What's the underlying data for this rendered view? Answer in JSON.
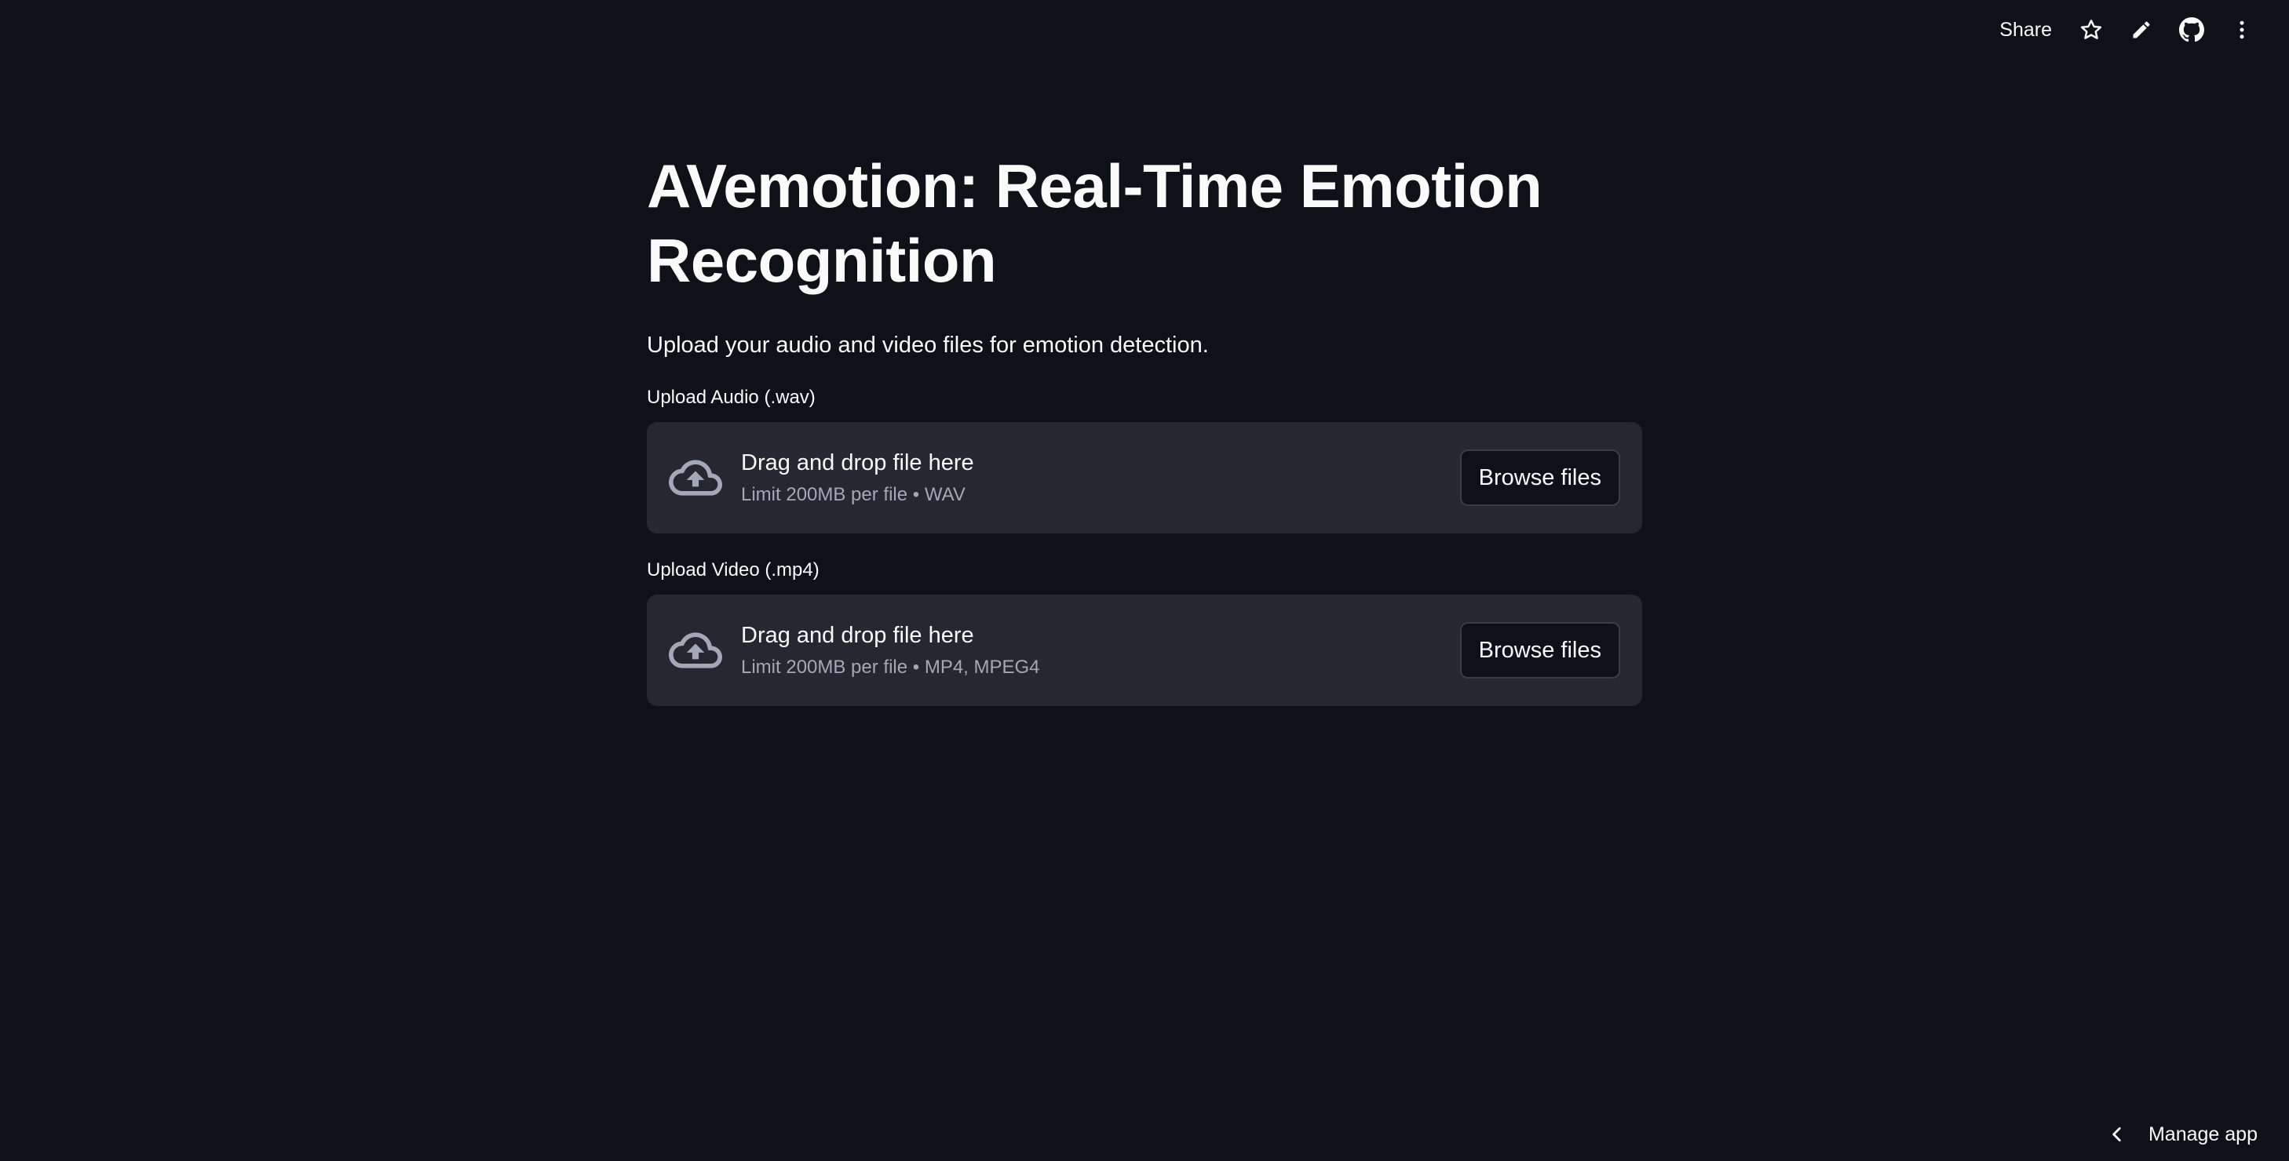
{
  "toolbar": {
    "share_label": "Share",
    "icons": [
      "star-icon",
      "pencil-icon",
      "github-icon",
      "more-vertical-icon"
    ]
  },
  "main": {
    "title": "AVemotion: Real-Time Emotion Recognition",
    "subtitle": "Upload your audio and video files for emotion detection.",
    "uploaders": [
      {
        "label": "Upload Audio (.wav)",
        "drop_text": "Drag and drop file here",
        "limit_text": "Limit 200MB per file • WAV",
        "button_label": "Browse files",
        "icon": "cloud-upload-icon"
      },
      {
        "label": "Upload Video (.mp4)",
        "drop_text": "Drag and drop file here",
        "limit_text": "Limit 200MB per file • MP4, MPEG4",
        "button_label": "Browse files",
        "icon": "cloud-upload-icon"
      }
    ]
  },
  "footer": {
    "manage_label": "Manage app",
    "icon": "chevron-left-icon"
  },
  "colors": {
    "background": "#0e1117",
    "surface": "#262730",
    "text": "#fafafa",
    "muted_text": "#a3a8b8"
  }
}
